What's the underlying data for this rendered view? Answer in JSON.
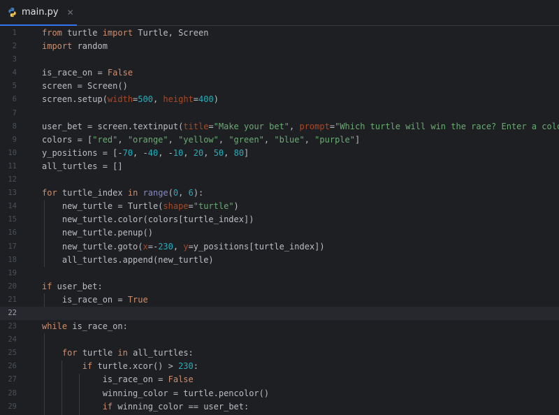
{
  "tab": {
    "filename": "main.py",
    "icon": "python-icon",
    "close_glyph": "✕"
  },
  "colors": {
    "background": "#1e1f22",
    "keyword": "#cf8e6d",
    "function": "#56a8f5",
    "string": "#6aab73",
    "number": "#2aacb8",
    "parameter": "#aa4926",
    "builtin": "#8888c6",
    "accent": "#3574f0"
  },
  "editor": {
    "current_line": 22,
    "lines": [
      {
        "n": "1",
        "t": "from turtle import Turtle, Screen"
      },
      {
        "n": "2",
        "t": "import random"
      },
      {
        "n": "3",
        "t": ""
      },
      {
        "n": "4",
        "t": "is_race_on = False"
      },
      {
        "n": "5",
        "t": "screen = Screen()"
      },
      {
        "n": "6",
        "t": "screen.setup(width=500, height=400)"
      },
      {
        "n": "7",
        "t": ""
      },
      {
        "n": "8",
        "t": "user_bet = screen.textinput(title=\"Make your bet\", prompt=\"Which turtle will win the race? Enter a color: \")"
      },
      {
        "n": "9",
        "t": "colors = [\"red\", \"orange\", \"yellow\", \"green\", \"blue\", \"purple\"]"
      },
      {
        "n": "10",
        "t": "y_positions = [-70, -40, -10, 20, 50, 80]"
      },
      {
        "n": "11",
        "t": "all_turtles = []"
      },
      {
        "n": "12",
        "t": ""
      },
      {
        "n": "13",
        "t": "for turtle_index in range(0, 6):"
      },
      {
        "n": "14",
        "t": "    new_turtle = Turtle(shape=\"turtle\")"
      },
      {
        "n": "15",
        "t": "    new_turtle.color(colors[turtle_index])"
      },
      {
        "n": "16",
        "t": "    new_turtle.penup()"
      },
      {
        "n": "17",
        "t": "    new_turtle.goto(x=-230, y=y_positions[turtle_index])"
      },
      {
        "n": "18",
        "t": "    all_turtles.append(new_turtle)"
      },
      {
        "n": "19",
        "t": ""
      },
      {
        "n": "20",
        "t": "if user_bet:"
      },
      {
        "n": "21",
        "t": "    is_race_on = True"
      },
      {
        "n": "22",
        "t": ""
      },
      {
        "n": "23",
        "t": "while is_race_on:"
      },
      {
        "n": "24",
        "t": ""
      },
      {
        "n": "25",
        "t": "    for turtle in all_turtles:"
      },
      {
        "n": "26",
        "t": "        if turtle.xcor() > 230:"
      },
      {
        "n": "27",
        "t": "            is_race_on = False"
      },
      {
        "n": "28",
        "t": "            winning_color = turtle.pencolor()"
      },
      {
        "n": "29",
        "t": "            if winning_color == user_bet:"
      }
    ]
  }
}
